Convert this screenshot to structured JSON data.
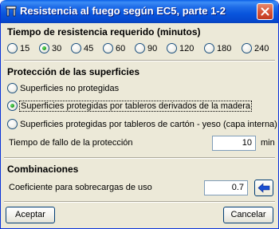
{
  "window": {
    "title": "Resistencia al fuego según EC5, parte 1-2"
  },
  "resistance": {
    "heading": "Tiempo de resistencia requerido (minutos)",
    "options": [
      "15",
      "30",
      "45",
      "60",
      "90",
      "120",
      "180",
      "240"
    ],
    "selected": "30"
  },
  "protection": {
    "heading": "Protección de las superficies",
    "options": [
      "Superficies no protegidas",
      "Superficies protegidas por tableros derivados de la madera",
      "Superficies protegidas por tableros de cartón - yeso (capa interna)"
    ],
    "selected_index": 1,
    "failure_label": "Tiempo de fallo de la protección",
    "failure_value": "10",
    "failure_unit": "min"
  },
  "combinations": {
    "heading": "Combinaciones",
    "coef_label": "Coeficiente para sobrecargas de uso",
    "coef_value": "0.7"
  },
  "buttons": {
    "accept_label": "Aceptar",
    "cancel_label": "Cancelar"
  },
  "colors": {
    "title_bar": "#0854dc",
    "dialog_bg": "#ece9d8",
    "arrow": "#1b4fd1",
    "radio_dot": "#21a121"
  }
}
